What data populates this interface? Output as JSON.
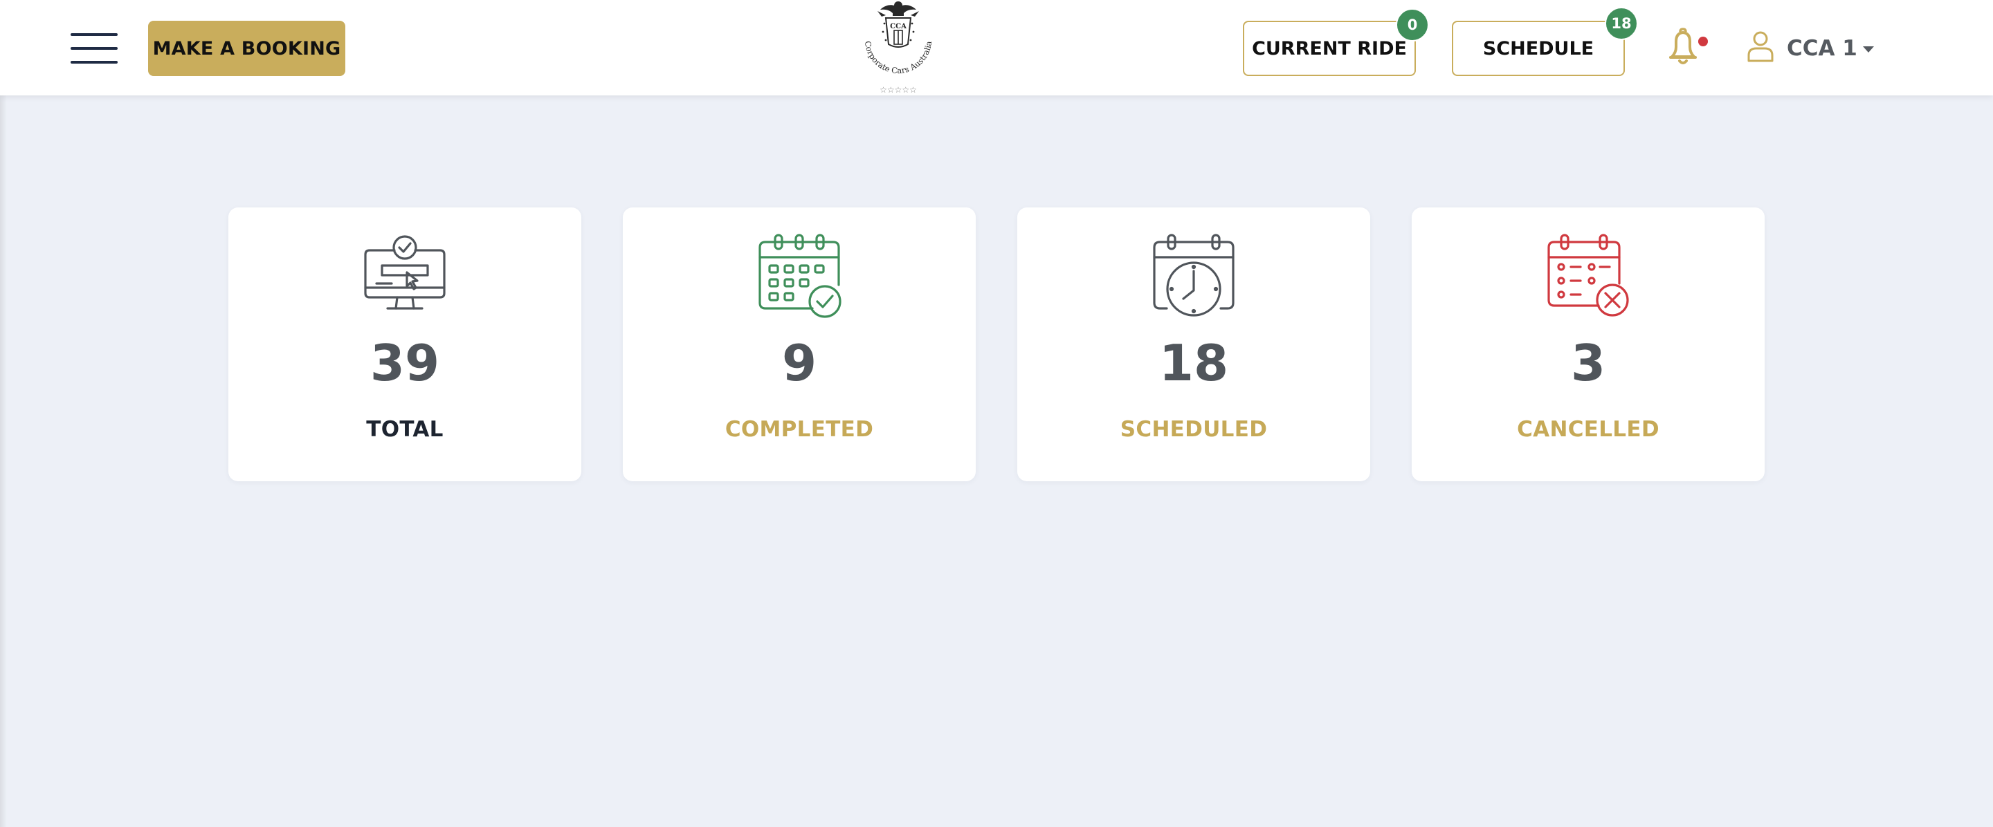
{
  "header": {
    "make_booking_label": "MAKE A BOOKING",
    "current_ride_label": "CURRENT RIDE",
    "current_ride_count": "0",
    "schedule_label": "SCHEDULE",
    "schedule_count": "18",
    "notification_dot": true,
    "user_name": "CCA 1",
    "logo": {
      "text": "Corporate Cars Australia",
      "abbr": "CCA",
      "stars": "☆☆☆☆☆"
    }
  },
  "stats": [
    {
      "count": "39",
      "label": "TOTAL",
      "icon": "monitor-check-icon"
    },
    {
      "count": "9",
      "label": "COMPLETED",
      "icon": "calendar-check-icon"
    },
    {
      "count": "18",
      "label": "SCHEDULED",
      "icon": "calendar-clock-icon"
    },
    {
      "count": "3",
      "label": "CANCELLED",
      "icon": "calendar-cancel-icon"
    }
  ],
  "colors": {
    "gold": "#c9ad5c",
    "badge_green": "#3f8f5a",
    "completed_green": "#3f8f5a",
    "cancelled_red": "#d0393f",
    "notification_red": "#d0393f",
    "background": "#edf0f7"
  }
}
